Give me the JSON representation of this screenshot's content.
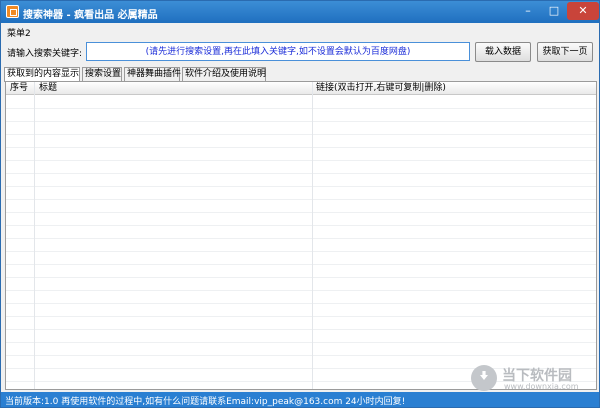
{
  "window": {
    "title": "搜索神器 - 疯看出品 必属精品"
  },
  "menubar": {
    "items": [
      "菜单2"
    ]
  },
  "search": {
    "label": "请输入搜索关键字:",
    "placeholder": "(请先进行搜索设置,再在此填入关键字,如不设置会默认为百度网盘)",
    "load_button": "载入数据",
    "next_button": "获取下一页"
  },
  "tabs": [
    {
      "label": "获取到的内容显示",
      "active": true
    },
    {
      "label": "搜索设置",
      "active": false
    },
    {
      "label": "神器舞曲插件",
      "active": false
    },
    {
      "label": "软件介绍及使用说明",
      "active": false
    }
  ],
  "table": {
    "columns": [
      "序号",
      "标题",
      "链接(双击打开,右键可复制|删除)"
    ],
    "rows": []
  },
  "status": {
    "text": "当前版本:1.0    再使用软件的过程中,如有什么问题请联系Email:vip_peak@163.com 24小时内回复!"
  },
  "watermark": {
    "title": "当下软件园",
    "subtitle": "www.downxia.com"
  },
  "colors": {
    "titlebar": "#2a7fd2",
    "statusbar": "#2a7fd2",
    "accent": "#1a2bd8"
  }
}
